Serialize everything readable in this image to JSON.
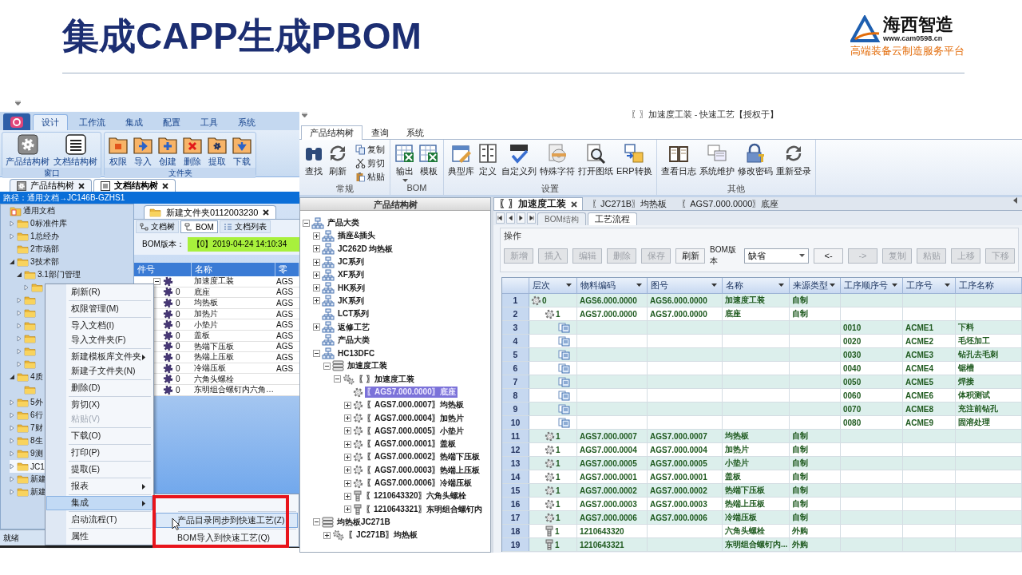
{
  "slide": {
    "title": "集成CAPP生成PBOM",
    "logo": {
      "name": "海西智造",
      "url": "www.cam0598.cn",
      "tagline": "高端装备云制造服务平台"
    }
  },
  "left_app": {
    "ribbon_tabs": [
      {
        "label": "设计",
        "selected": true
      },
      {
        "label": "工作流",
        "selected": false
      },
      {
        "label": "集成",
        "selected": false
      },
      {
        "label": "配置",
        "selected": false
      },
      {
        "label": "工具",
        "selected": false
      },
      {
        "label": "系统",
        "selected": false
      }
    ],
    "ribbon_groups": [
      {
        "label": "窗口",
        "buttons": [
          "产品结构树",
          "文档结构树"
        ]
      },
      {
        "label": "文件夹",
        "buttons": [
          "权限",
          "导入",
          "创建",
          "删除",
          "提取",
          "下载"
        ]
      }
    ],
    "doc_tabs": [
      {
        "label": "产品结构树",
        "selected": false
      },
      {
        "label": "文档结构树",
        "selected": true
      }
    ],
    "path": "路径：通用文档→JC146B-GZHS1",
    "folder_tree": [
      {
        "label": "通用文档",
        "kind": "root",
        "selected": false,
        "children": [
          {
            "label": "0标准件库",
            "kind": "folder",
            "expanded": false,
            "selected": false
          },
          {
            "label": "1总经办",
            "kind": "folder",
            "expanded": false,
            "selected": false
          },
          {
            "label": "2市场部",
            "kind": "folder",
            "selected": false
          },
          {
            "label": "3技术部",
            "kind": "folder",
            "expanded": true,
            "selected": false,
            "children": [
              {
                "label": "3.1部门管理",
                "kind": "folder",
                "expanded": true,
                "selected": false,
                "children": [
                  {
                    "kind": "folder",
                    "expanded": false,
                    "selected": false
                  }
                ]
              },
              {
                "kind": "folder",
                "expanded": false,
                "selected": false
              },
              {
                "kind": "folder",
                "expanded": false,
                "selected": false
              },
              {
                "kind": "folder",
                "expanded": false,
                "selected": false
              },
              {
                "kind": "folder",
                "expanded": false,
                "selected": false
              },
              {
                "kind": "folder",
                "expanded": false,
                "selected": false
              },
              {
                "kind": "folder",
                "expanded": false,
                "selected": false
              }
            ]
          },
          {
            "label": "4质",
            "kind": "folder",
            "expanded": true,
            "selected": false,
            "children": [
              {
                "kind": "folder",
                "selected": false
              }
            ]
          },
          {
            "label": "5外",
            "kind": "folder",
            "expanded": false,
            "selected": false
          },
          {
            "label": "6行",
            "kind": "folder",
            "expanded": false,
            "selected": false
          },
          {
            "label": "7财",
            "kind": "folder",
            "expanded": false,
            "selected": false
          },
          {
            "label": "8生",
            "kind": "folder",
            "expanded": false,
            "selected": false
          },
          {
            "label": "9测",
            "kind": "folder",
            "expanded": false,
            "selected": false
          },
          {
            "label": "JC1",
            "kind": "folder",
            "expanded": false,
            "selected": true
          },
          {
            "label": "新建",
            "kind": "folder",
            "expanded": false,
            "selected": false
          },
          {
            "label": "新建",
            "kind": "folder",
            "expanded": false,
            "selected": false
          }
        ]
      }
    ],
    "doc_panel": {
      "tab": "新建文件夹0112003230",
      "sub_tabs": [
        {
          "label": "文档树",
          "selected": false
        },
        {
          "label": "BOM",
          "selected": true
        },
        {
          "label": "文档列表",
          "selected": false
        }
      ],
      "bom_version_label": "BOM版本：",
      "bom_version": "【0】2019-04-24 14:10:34",
      "columns": [
        "件号",
        "名称",
        "零"
      ],
      "rows": [
        {
          "name": "加速度工装",
          "code": "AGS",
          "expanded": true,
          "children": [
            {
              "part_no": "0",
              "name": "底座",
              "code": "AGS"
            },
            {
              "part_no": "0",
              "name": "均热板",
              "code": "AGS"
            },
            {
              "part_no": "0",
              "name": "加热片",
              "code": "AGS"
            },
            {
              "part_no": "0",
              "name": "小垫片",
              "code": "AGS"
            },
            {
              "part_no": "0",
              "name": "盖板",
              "code": "AGS"
            },
            {
              "part_no": "0",
              "name": "热端下压板",
              "code": "AGS"
            },
            {
              "part_no": "0",
              "name": "热端上压板",
              "code": "AGS"
            },
            {
              "part_no": "0",
              "name": "冷端压板",
              "code": "AGS"
            },
            {
              "part_no": "0",
              "name": "六角头螺栓"
            },
            {
              "part_no": "0",
              "name": "东明组合螺钉内六角…"
            }
          ]
        }
      ]
    },
    "context_menu": [
      [
        {
          "label": "刷新(R)",
          "disabled": false,
          "submenu": false,
          "selected": false
        }
      ],
      [
        {
          "label": "权限管理(M)",
          "disabled": false,
          "submenu": false,
          "selected": false
        }
      ],
      [
        {
          "label": "导入文档(I)",
          "disabled": false,
          "submenu": false,
          "selected": false
        },
        {
          "label": "导入文件夹(F)",
          "disabled": false,
          "submenu": false,
          "selected": false
        }
      ],
      [
        {
          "label": "新建模板库文件夹",
          "disabled": false,
          "submenu": true,
          "selected": false
        },
        {
          "label": "新建子文件夹(N)",
          "disabled": false,
          "submenu": false,
          "selected": false
        }
      ],
      [
        {
          "label": "删除(D)",
          "disabled": false,
          "submenu": false,
          "selected": false
        }
      ],
      [
        {
          "label": "剪切(X)",
          "disabled": false,
          "submenu": false,
          "selected": false
        },
        {
          "label": "粘贴(V)",
          "disabled": true,
          "submenu": false,
          "selected": false
        }
      ],
      [
        {
          "label": "下载(O)",
          "disabled": false,
          "submenu": false,
          "selected": false
        }
      ],
      [
        {
          "label": "打印(P)",
          "disabled": false,
          "submenu": false,
          "selected": false
        }
      ],
      [
        {
          "label": "提取(E)",
          "disabled": false,
          "submenu": false,
          "selected": false
        }
      ],
      [
        {
          "label": "报表",
          "disabled": false,
          "submenu": true,
          "selected": false
        }
      ],
      [
        {
          "label": "集成",
          "disabled": false,
          "submenu": true,
          "selected": true
        }
      ],
      [
        {
          "label": "启动流程(T)",
          "disabled": false,
          "submenu": false,
          "selected": false
        }
      ],
      [
        {
          "label": "属性",
          "disabled": false,
          "submenu": false,
          "selected": false
        }
      ]
    ],
    "submenu": [
      {
        "label": "产品目录同步到快速工艺(Z)",
        "selected": true
      },
      {
        "label": "BOM导入到快速工艺(Q)",
        "selected": false
      }
    ],
    "status": "就绪"
  },
  "right_app": {
    "title": "〖〗加速度工装 - 快速工艺【授权于】",
    "ribbon_tabs": [
      {
        "label": "产品结构树",
        "selected": true
      },
      {
        "label": "查询",
        "selected": false
      },
      {
        "label": "系统",
        "selected": false
      }
    ],
    "ribbon_groups": [
      {
        "label": "常规",
        "buttons": [
          {
            "label": "查找",
            "kind": "large"
          },
          {
            "label": "刷新",
            "kind": "large"
          },
          {
            "label": "复制",
            "kind": "small"
          },
          {
            "label": "剪切",
            "kind": "small"
          },
          {
            "label": "粘贴",
            "kind": "small"
          }
        ]
      },
      {
        "label": "BOM",
        "buttons": [
          {
            "label": "输出",
            "kind": "split"
          },
          {
            "label": "模板",
            "kind": "large"
          }
        ]
      },
      {
        "label": "设置",
        "buttons": [
          {
            "label": "典型库",
            "kind": "large"
          },
          {
            "label": "定义",
            "kind": "large"
          },
          {
            "label": "自定义列",
            "kind": "large"
          },
          {
            "label": "特殊字符",
            "kind": "large"
          },
          {
            "label": "打开图纸",
            "kind": "large"
          },
          {
            "label": "ERP转换",
            "kind": "large"
          }
        ]
      },
      {
        "label": "其他",
        "buttons": [
          {
            "label": "查看日志",
            "kind": "large"
          },
          {
            "label": "系统维护",
            "kind": "large"
          },
          {
            "label": "修改密码",
            "kind": "large"
          },
          {
            "label": "重新登录",
            "kind": "large"
          }
        ]
      }
    ],
    "tree_title": "产品结构树",
    "tree": [
      {
        "label": "产品大类",
        "kind": "category",
        "expanded": true,
        "selected": false,
        "children": [
          {
            "label": "插座&插头",
            "kind": "category",
            "expanded": false,
            "selected": false
          },
          {
            "label": "JC262D 均热板",
            "kind": "category",
            "expanded": false,
            "selected": false
          },
          {
            "label": "JC系列",
            "kind": "category",
            "expanded": false,
            "selected": false
          },
          {
            "label": "XF系列",
            "kind": "category",
            "expanded": false,
            "selected": false
          },
          {
            "label": "HK系列",
            "kind": "category",
            "expanded": false,
            "selected": false
          },
          {
            "label": "JK系列",
            "kind": "category",
            "expanded": false,
            "selected": false
          },
          {
            "label": "LCT系列",
            "kind": "category",
            "selected": false
          },
          {
            "label": "返修工艺",
            "kind": "category",
            "expanded": false,
            "selected": false
          },
          {
            "label": "产品大类",
            "kind": "category",
            "selected": false
          },
          {
            "label": "HC13DFC",
            "kind": "category",
            "expanded": true,
            "selected": false,
            "children": [
              {
                "label": "加速度工装",
                "kind": "assembly",
                "expanded": true,
                "selected": false,
                "children": [
                  {
                    "label": "〖〗加速度工装",
                    "kind": "product",
                    "expanded": true,
                    "selected": false,
                    "children": [
                      {
                        "label": "〖AGS7.000.0000〗底座",
                        "kind": "part",
                        "selected": true
                      },
                      {
                        "label": "〖AGS7.000.0007〗均热板",
                        "kind": "part",
                        "expanded": false,
                        "selected": false
                      },
                      {
                        "label": "〖AGS7.000.0004〗加热片",
                        "kind": "part",
                        "expanded": false,
                        "selected": false
                      },
                      {
                        "label": "〖AGS7.000.0005〗小垫片",
                        "kind": "part",
                        "expanded": false,
                        "selected": false
                      },
                      {
                        "label": "〖AGS7.000.0001〗盖板",
                        "kind": "part",
                        "expanded": false,
                        "selected": false
                      },
                      {
                        "label": "〖AGS7.000.0002〗热端下压板",
                        "kind": "part",
                        "expanded": false,
                        "selected": false
                      },
                      {
                        "label": "〖AGS7.000.0003〗热端上压板",
                        "kind": "part",
                        "expanded": false,
                        "selected": false
                      },
                      {
                        "label": "〖AGS7.000.0006〗冷端压板",
                        "kind": "part",
                        "expanded": false,
                        "selected": false
                      },
                      {
                        "label": "〖1210643320〗六角头螺栓",
                        "kind": "standard",
                        "expanded": false,
                        "selected": false
                      },
                      {
                        "label": "〖1210643321〗东明组合螺钉内",
                        "kind": "standard",
                        "expanded": false,
                        "selected": false
                      }
                    ]
                  }
                ]
              }
            ]
          },
          {
            "label": "均热板JC271B",
            "kind": "assembly",
            "expanded": true,
            "selected": false,
            "children": [
              {
                "label": "〖JC271B〗均热板",
                "kind": "product",
                "expanded": false,
                "selected": false
              }
            ]
          }
        ]
      }
    ],
    "doc_tabs": [
      {
        "label": "〖〗加速度工装",
        "selected": true
      },
      {
        "label": "〖JC271B〗均热板",
        "selected": false
      },
      {
        "label": "〖AGS7.000.0000〗底座",
        "selected": false
      }
    ],
    "sub_tabs": [
      {
        "label": "BOM结构",
        "selected": false
      },
      {
        "label": "工艺流程",
        "selected": true
      }
    ],
    "ops_title": "操作",
    "ops": [
      {
        "kind": "button",
        "label": "新增",
        "disabled": true
      },
      {
        "kind": "button",
        "label": "插入",
        "disabled": true
      },
      {
        "kind": "button",
        "label": "编辑",
        "disabled": true
      },
      {
        "kind": "button",
        "label": "删除",
        "disabled": true
      },
      {
        "kind": "button",
        "label": "保存",
        "disabled": true
      },
      {
        "kind": "button",
        "label": "刷新",
        "disabled": false
      },
      {
        "kind": "select",
        "label": "BOM版本",
        "value": "缺省"
      },
      {
        "kind": "button",
        "label": "<-",
        "disabled": false
      },
      {
        "kind": "button",
        "label": "->",
        "disabled": true
      },
      {
        "kind": "button",
        "label": "复制",
        "disabled": true
      },
      {
        "kind": "button",
        "label": "粘贴",
        "disabled": true
      },
      {
        "kind": "button",
        "label": "上移",
        "disabled": true
      },
      {
        "kind": "button",
        "label": "下移",
        "disabled": true
      }
    ],
    "grid": {
      "columns": [
        "层次",
        "物料编码",
        "图号",
        "名称",
        "来源类型",
        "工序顺序号",
        "工序号",
        "工序名称"
      ],
      "rows": [
        {
          "num": "1",
          "kind": "part",
          "tier": "0",
          "code": "AGS6.000.0000",
          "drawing": "AGS6.000.0000",
          "name": "加速度工装",
          "source": "自制",
          "children": [
            {
              "num": "2",
              "kind": "part",
              "tier": "1",
              "code": "AGS7.000.0000",
              "drawing": "AGS7.000.0000",
              "name": "底座",
              "source": "自制",
              "children": [
                {
                  "num": "3",
                  "kind": "process",
                  "seq": "0010",
                  "op": "ACME1",
                  "op_name": "下料"
                },
                {
                  "num": "4",
                  "kind": "process",
                  "seq": "0020",
                  "op": "ACME2",
                  "op_name": "毛坯加工"
                },
                {
                  "num": "5",
                  "kind": "process",
                  "seq": "0030",
                  "op": "ACME3",
                  "op_name": "钻孔去毛刺"
                },
                {
                  "num": "6",
                  "kind": "process",
                  "seq": "0040",
                  "op": "ACME4",
                  "op_name": "锯槽"
                },
                {
                  "num": "7",
                  "kind": "process",
                  "seq": "0050",
                  "op": "ACME5",
                  "op_name": "焊接"
                },
                {
                  "num": "8",
                  "kind": "process",
                  "seq": "0060",
                  "op": "ACME6",
                  "op_name": "体积测试"
                },
                {
                  "num": "9",
                  "kind": "process",
                  "seq": "0070",
                  "op": "ACME8",
                  "op_name": "充注前钻孔"
                },
                {
                  "num": "10",
                  "kind": "process",
                  "seq": "0080",
                  "op": "ACME9",
                  "op_name": "固溶处理"
                }
              ]
            },
            {
              "num": "11",
              "kind": "part",
              "tier": "1",
              "code": "AGS7.000.0007",
              "drawing": "AGS7.000.0007",
              "name": "均热板",
              "source": "自制"
            },
            {
              "num": "12",
              "kind": "part",
              "tier": "1",
              "code": "AGS7.000.0004",
              "drawing": "AGS7.000.0004",
              "name": "加热片",
              "source": "自制"
            },
            {
              "num": "13",
              "kind": "part",
              "tier": "1",
              "code": "AGS7.000.0005",
              "drawing": "AGS7.000.0005",
              "name": "小垫片",
              "source": "自制"
            },
            {
              "num": "14",
              "kind": "part",
              "tier": "1",
              "code": "AGS7.000.0001",
              "drawing": "AGS7.000.0001",
              "name": "盖板",
              "source": "自制"
            },
            {
              "num": "15",
              "kind": "part",
              "tier": "1",
              "code": "AGS7.000.0002",
              "drawing": "AGS7.000.0002",
              "name": "热端下压板",
              "source": "自制"
            },
            {
              "num": "16",
              "kind": "part",
              "tier": "1",
              "code": "AGS7.000.0003",
              "drawing": "AGS7.000.0003",
              "name": "热端上压板",
              "source": "自制"
            },
            {
              "num": "17",
              "kind": "part",
              "tier": "1",
              "code": "AGS7.000.0006",
              "drawing": "AGS7.000.0006",
              "name": "冷端压板",
              "source": "自制"
            },
            {
              "num": "18",
              "kind": "standard",
              "tier": "1",
              "code": "1210643320",
              "name": "六角头螺栓",
              "source": "外购"
            },
            {
              "num": "19",
              "kind": "standard",
              "tier": "1",
              "code": "1210643321",
              "name": "东明组合螺钉内...",
              "source": "外购"
            }
          ]
        }
      ]
    }
  }
}
